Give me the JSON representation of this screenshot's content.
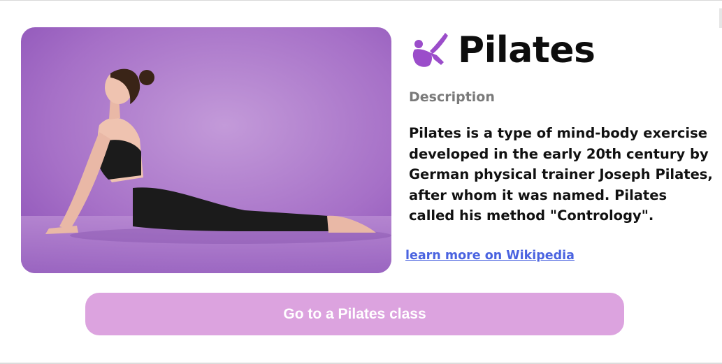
{
  "exercise": {
    "title": "Pilates",
    "icon": "pilates-pose-icon",
    "description_label": "Description",
    "description": "Pilates is a type of mind-body exercise developed in the early 20th century by German physical trainer Joseph Pilates, after whom it was named. Pilates called his method \"Contrology\".",
    "link_text": "learn more on Wikipedia",
    "cta_label": "Go to a Pilates class"
  },
  "colors": {
    "accent": "#9b4dca",
    "button_bg": "#dca3df",
    "link": "#4a63e0",
    "photo_bg": "#a86cc4"
  }
}
